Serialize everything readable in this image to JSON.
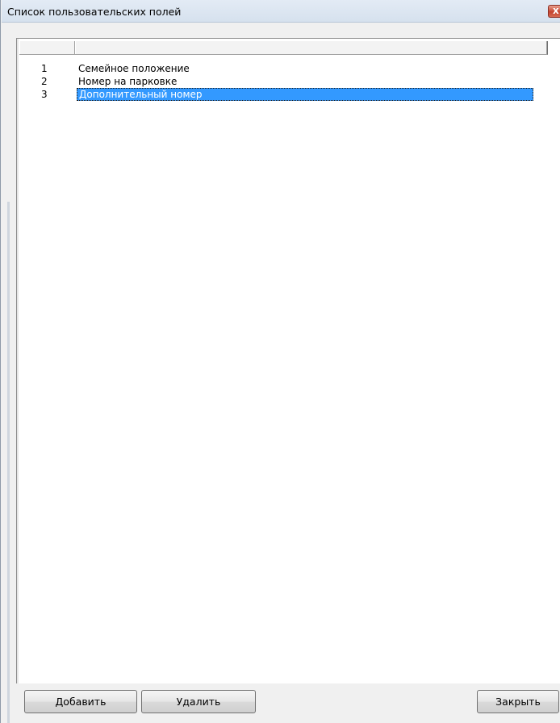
{
  "window": {
    "title": "Список пользовательских полей",
    "close_glyph": "x"
  },
  "list": {
    "columns": [
      "",
      ""
    ],
    "rows": [
      {
        "num": "1",
        "name": "Семейное положение"
      },
      {
        "num": "2",
        "name": "Номер на парковке"
      },
      {
        "num": "3",
        "name": "Дополнительный номер"
      }
    ],
    "selected_row": 3
  },
  "buttons": {
    "add": "Добавить",
    "delete": "Удалить",
    "close": "Закрыть"
  },
  "colors": {
    "selection": "#3399ff",
    "window_bg": "#f0f0f0",
    "close_button": "#c5432f"
  }
}
